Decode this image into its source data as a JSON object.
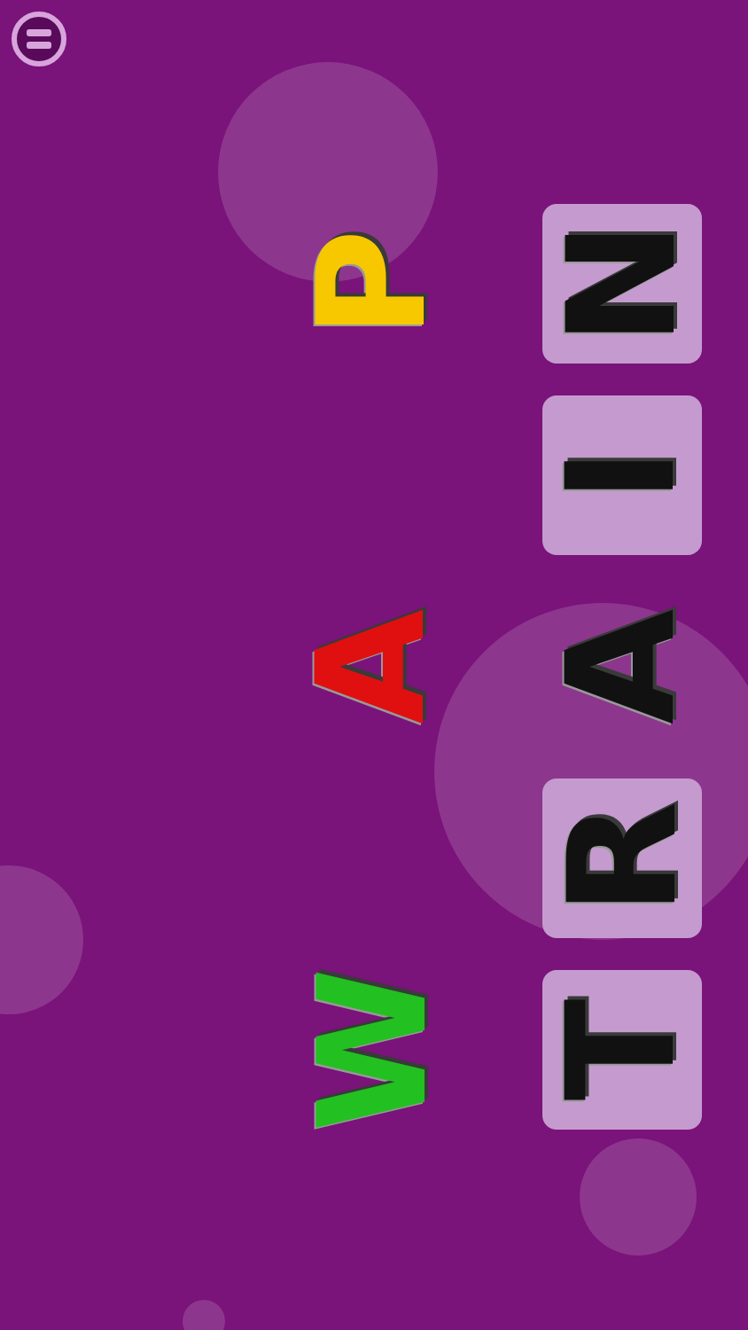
{
  "choices": [
    {
      "letter": "P",
      "color": "#f7c800"
    },
    {
      "letter": "A",
      "color": "#e01010"
    },
    {
      "letter": "W",
      "color": "#22c020"
    }
  ],
  "slots": [
    {
      "letter": "N",
      "placed": false
    },
    {
      "letter": "I",
      "placed": false
    },
    {
      "letter": "A",
      "placed": true
    },
    {
      "letter": "R",
      "placed": false
    },
    {
      "letter": "T",
      "placed": false
    }
  ]
}
